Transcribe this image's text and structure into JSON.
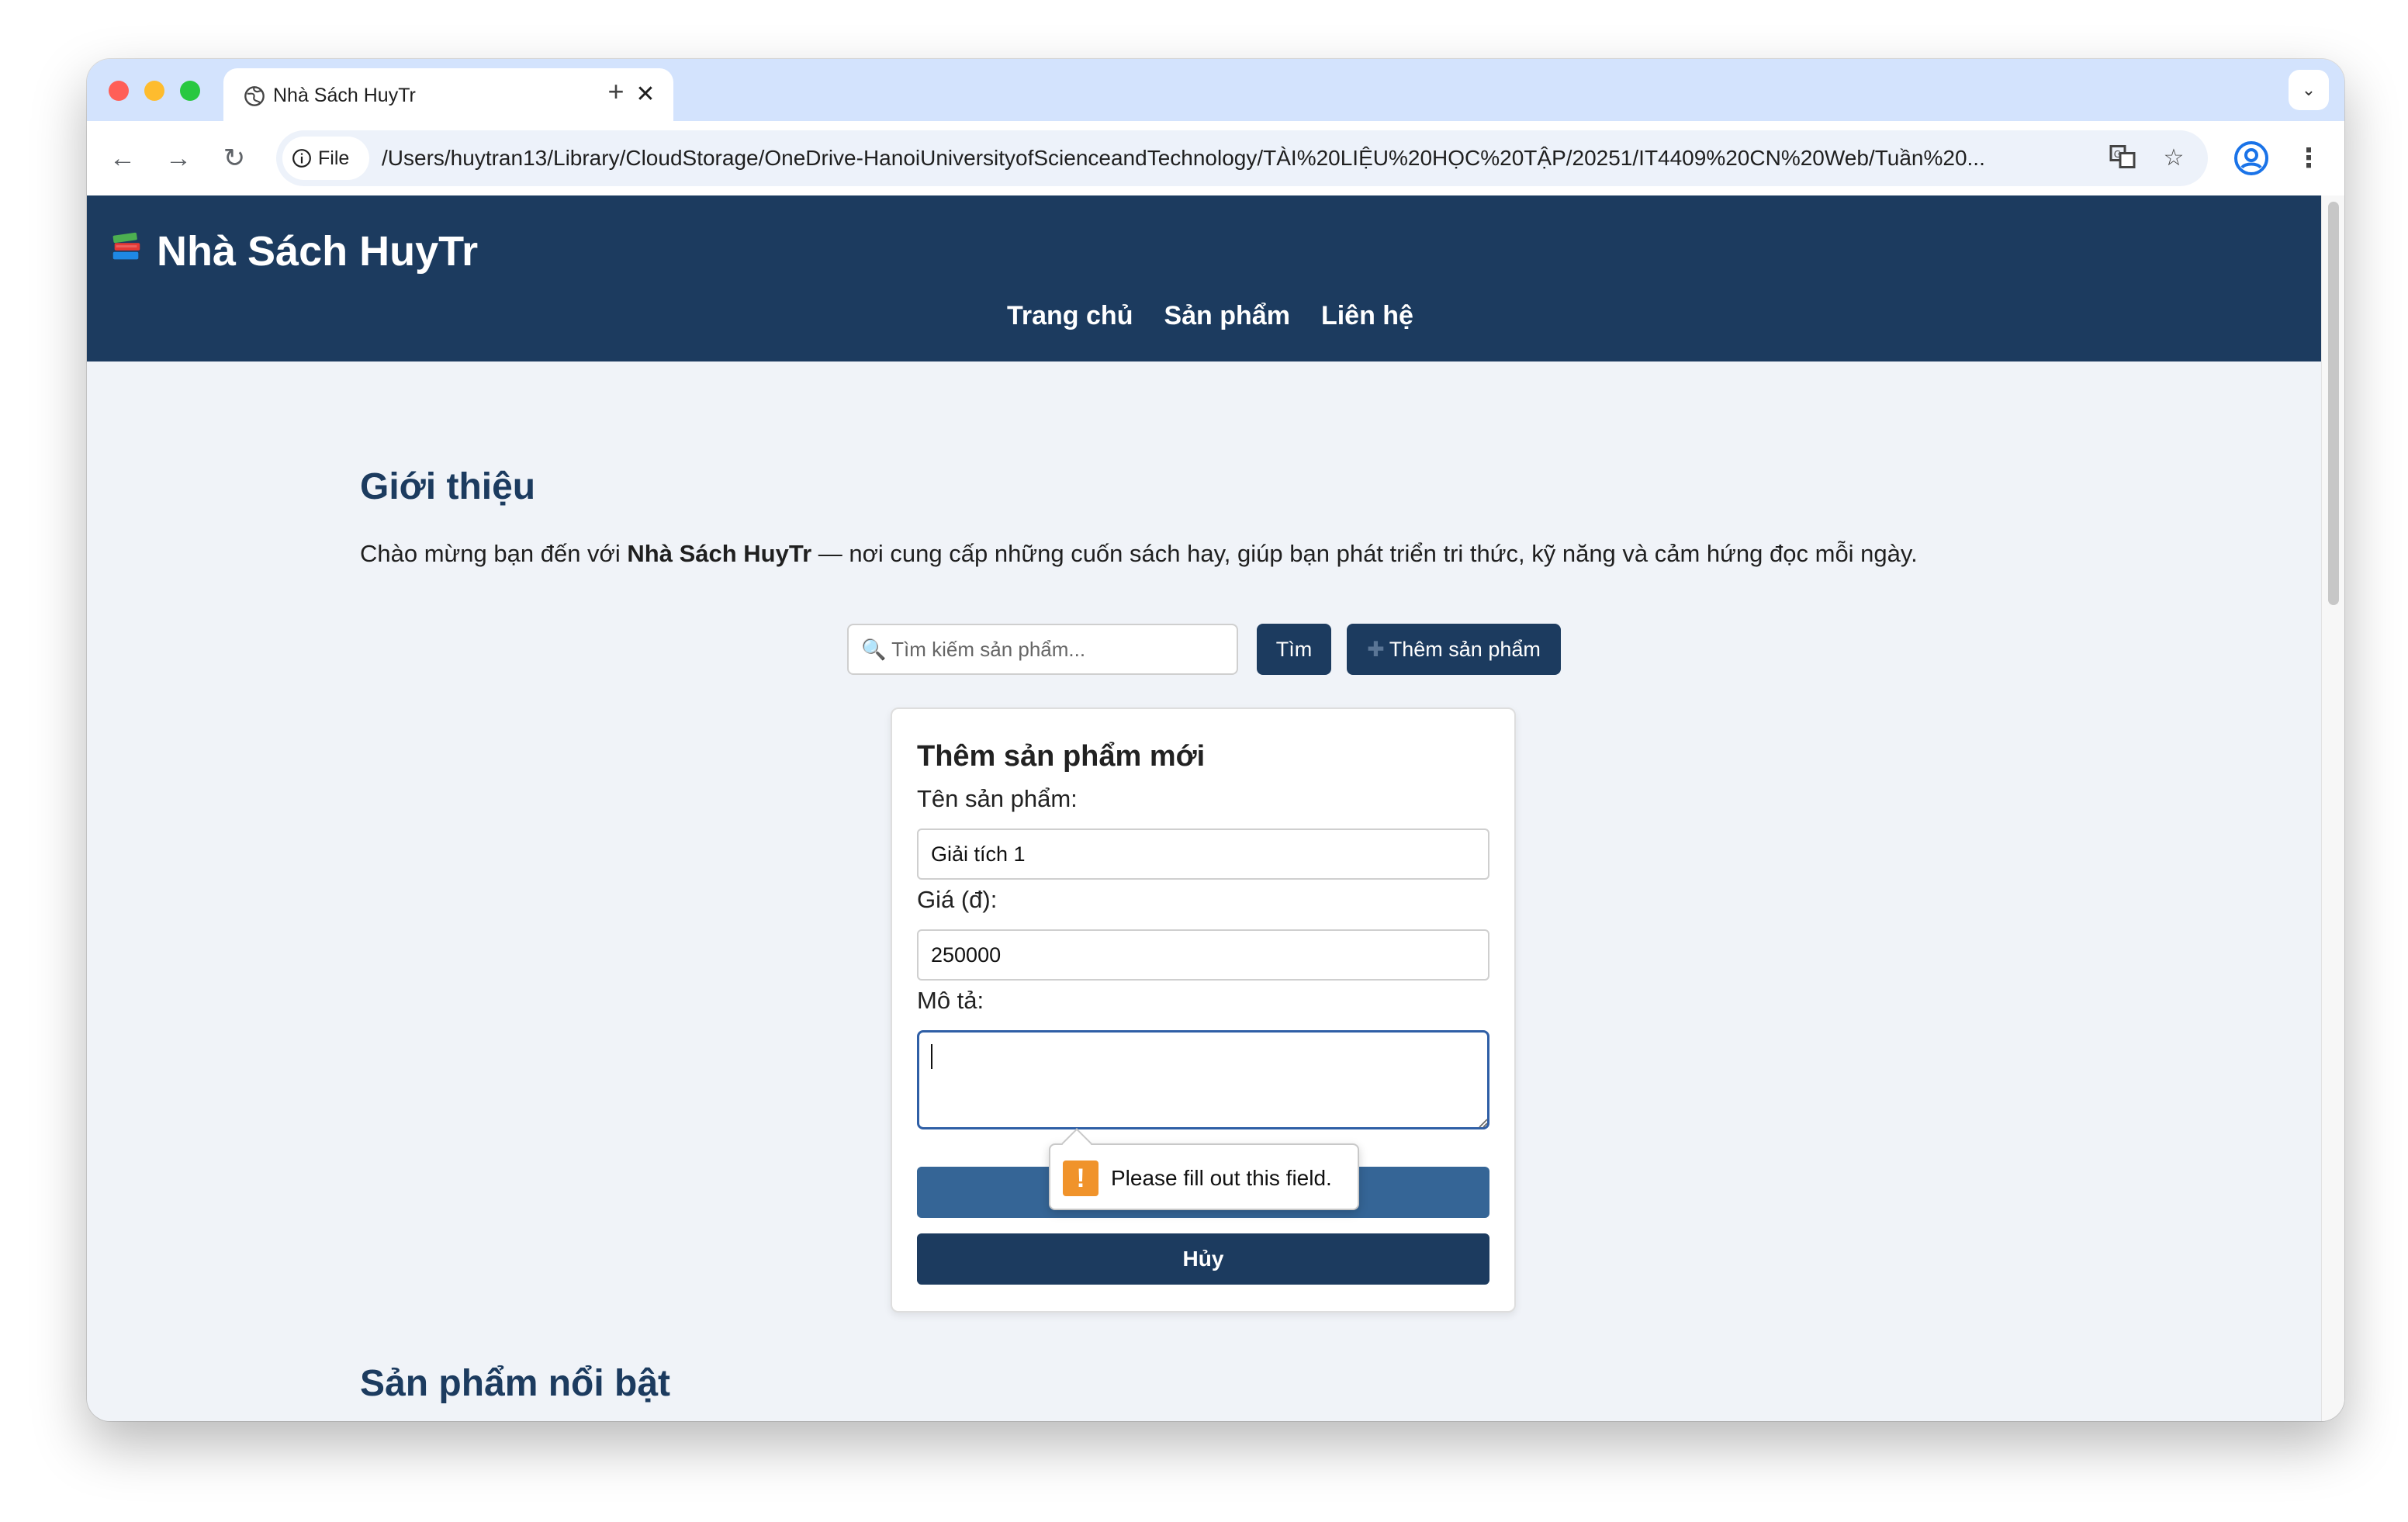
{
  "browser": {
    "tab_title": "Nhà Sách HuyTr",
    "tab_close": "✕",
    "new_tab": "+",
    "chip_label": "File",
    "url": "/Users/huytran13/Library/CloudStorage/OneDrive-HanoiUniversityofScienceandTechnology/TÀI%20LIỆU%20HỌC%20TẬP/20251/IT4409%20CN%20Web/Tuần%20..."
  },
  "site": {
    "title": "Nhà Sách HuyTr",
    "nav": [
      "Trang chủ",
      "Sản phẩm",
      "Liên hệ"
    ]
  },
  "intro": {
    "heading": "Giới thiệu",
    "text_before": "Chào mừng bạn đến với ",
    "text_bold": "Nhà Sách HuyTr",
    "text_after": " — nơi cung cấp những cuốn sách hay, giúp bạn phát triển tri thức, kỹ năng và cảm hứng đọc mỗi ngày."
  },
  "search": {
    "placeholder": "🔍 Tìm kiếm sản phẩm...",
    "button": "Tìm",
    "add_button": "Thêm sản phẩm"
  },
  "form": {
    "title": "Thêm sản phẩm mới",
    "name_label": "Tên sản phẩm:",
    "name_value": "Giải tích 1",
    "price_label": "Giá (đ):",
    "price_value": "250000",
    "desc_label": "Mô tả:",
    "desc_value": "",
    "cancel_button": "Hủy"
  },
  "validation": {
    "message": "Please fill out this field."
  },
  "featured": {
    "heading": "Sản phẩm nổi bật"
  },
  "colors": {
    "header_bg": "#1c3b5f",
    "save_button": "#356596",
    "warning": "#f0932b"
  }
}
